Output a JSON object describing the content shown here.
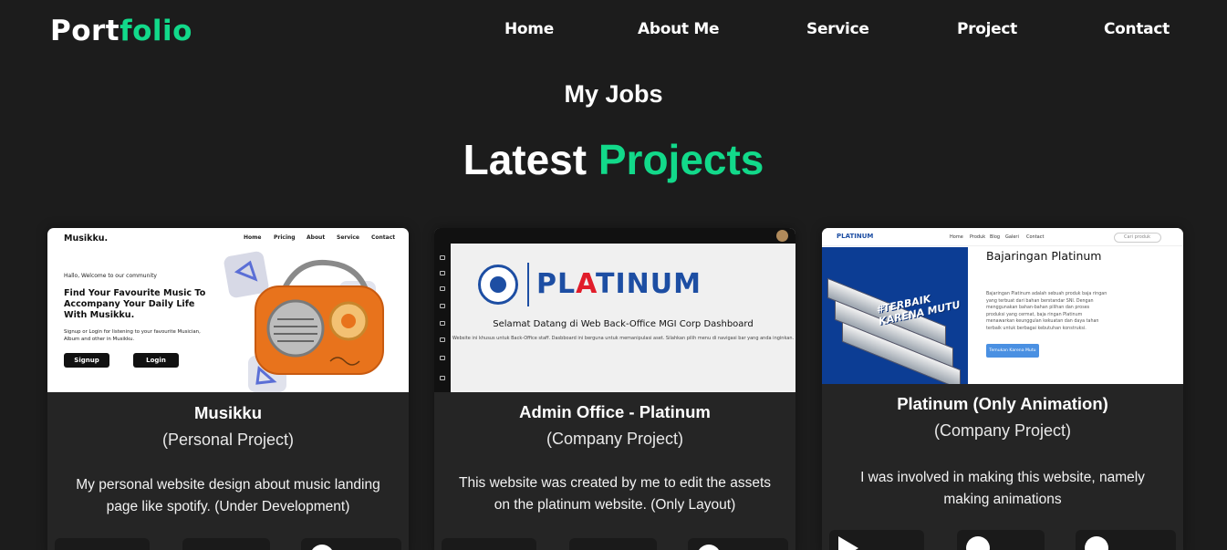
{
  "header": {
    "logo_main": "Port",
    "logo_accent": "folio",
    "nav": [
      "Home",
      "About Me",
      "Service",
      "Project",
      "Contact"
    ]
  },
  "section": {
    "subtitle": "My Jobs",
    "title_main": "Latest",
    "title_accent": "Projects"
  },
  "colors": {
    "accent": "#12d98a",
    "background": "#1c1c1c",
    "card": "#252525"
  },
  "projects": [
    {
      "name": "Musikku",
      "type": "(Personal Project)",
      "description": "My personal website design about music landing page like spotify. (Under Development)",
      "preview": {
        "brand": "Musikku.",
        "nav": [
          "Home",
          "Pricing",
          "About",
          "Service",
          "Contact"
        ],
        "greeting": "Hallo, Welcome to our community",
        "headline": "Find Your Favourite Music To Accompany Your Daily Life With Musikku.",
        "text": "Signup or Login for listening to your favourite Musician, Album and other in Musikku.",
        "buttons": [
          "Signup",
          "Login"
        ]
      }
    },
    {
      "name": "Admin Office - Platinum",
      "type": "(Company Project)",
      "description": "This website was created by me to edit the assets on the platinum website. (Only Layout)",
      "preview": {
        "wordmark_a": "PL",
        "wordmark_r": "A",
        "wordmark_b": "TINUM",
        "welcome": "Selamat Datang di Web Back-Office MGI Corp Dashboard",
        "text": "Website ini khusus untuk Back-Office staff. Dasbboard ini berguna untuk memanipulasi aset. Silahkan pilih menu di navigasi bar yang anda inginkan."
      }
    },
    {
      "name": "Platinum (Only Animation)",
      "type": "(Company Project)",
      "description": "I was involved in making this website, namely making animations",
      "preview": {
        "logo": "PLATINUM",
        "nav": [
          "Home",
          "Produk",
          "Blog",
          "Galeri",
          "Contact"
        ],
        "search": "Cari produk",
        "stamp": "#TERBAIK KARENA MUTU",
        "headline": "Bajaringan Platinum",
        "text": "Bajaringan Platinum adalah sebuah produk baja ringan yang terbuat dari bahan berstandar SNI. Dengan menggunakan bahan-bahan pilihan dan proses produksi yang cermat, baja ringan Platinum menawarkan keunggulan kekuatan dan daya tahan terbaik untuk berbagai kebutuhan konstruksi.",
        "cta": "Temukan Karena Mutu"
      }
    }
  ]
}
